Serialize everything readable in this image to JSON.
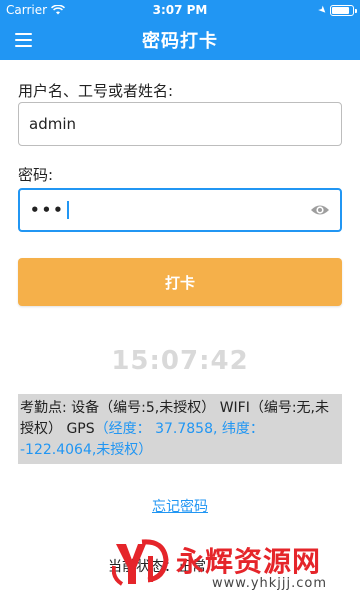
{
  "status_bar": {
    "carrier": "Carrier",
    "time": "3:07 PM",
    "icons": [
      "wifi-icon",
      "location-icon",
      "battery-icon"
    ]
  },
  "app_bar": {
    "title": "密码打卡",
    "menu_icon": "menu-icon",
    "color": "#2196F3"
  },
  "form": {
    "username_label": "用户名、工号或者姓名:",
    "username_value": "admin",
    "password_label": "密码:",
    "password_value": "•••",
    "password_toggle_icon": "eye-icon"
  },
  "punch_button": {
    "label": "打卡",
    "color": "#F5B04A"
  },
  "clock": "15:07:42",
  "info": {
    "prefix": "考勤点: 设备（编号:5,未授权） WIFI（编号:无,未授权） GPS",
    "gps": "（经度： 37.7858, 纬度： -122.4064,未授权）"
  },
  "forgot_password_link": "忘记密码",
  "bottom_text": "当前状态：正常",
  "watermark": {
    "title": "永辉资源网",
    "url": "www.yhkjjj.com"
  }
}
